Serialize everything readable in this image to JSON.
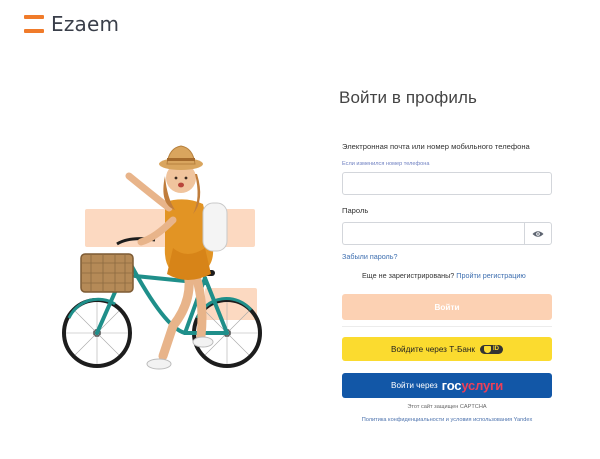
{
  "logo": {
    "text": "Ezaem"
  },
  "form": {
    "title": "Войти в профиль",
    "email_label": "Электронная почта или номер мобильного телефона",
    "phone_changed_hint": "Если изменился номер телефона",
    "email_value": "",
    "password_label": "Пароль",
    "password_value": "",
    "forgot_password": "Забыли пароль?",
    "not_registered": "Еще не зарегистрированы?",
    "register_link": "Пройти регистрацию",
    "login_button": "Войти",
    "tbank_button": "Войдите через Т-Банк",
    "tbank_badge": "ID",
    "gos_button_prefix": "Войти через",
    "gos_brand_a": "гос",
    "gos_brand_b": "услуги",
    "captcha_note": "Этот сайт защищен CAPTCHA",
    "policy_note": "Политика конфиденциальности и условия использования Yandex"
  },
  "colors": {
    "brand_orange": "#f07b2a",
    "login_button": "#fcd1b3",
    "tbank_yellow": "#fbdb2f",
    "gosuslugi_blue": "#1257a7",
    "link_blue": "#3e6fb0"
  }
}
